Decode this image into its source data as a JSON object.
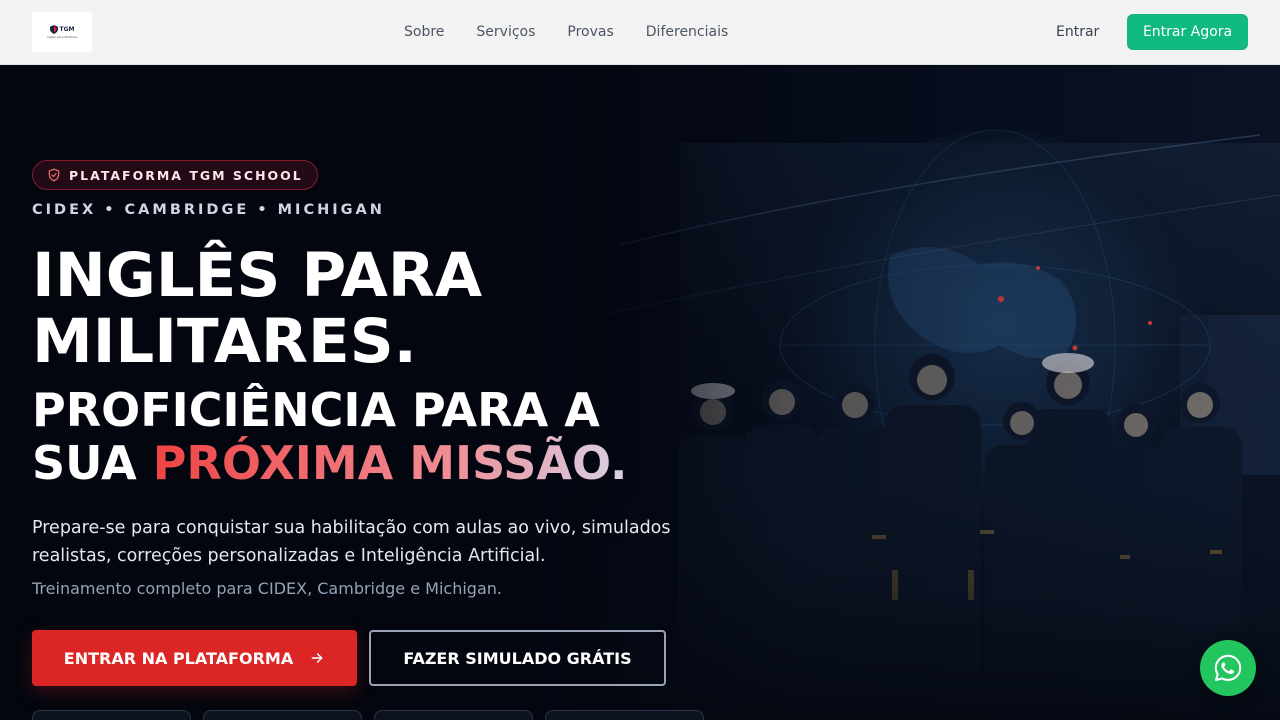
{
  "header": {
    "logo_text": "TGM",
    "logo_sub": "Inglês para Militares",
    "nav": [
      "Sobre",
      "Serviços",
      "Provas",
      "Diferenciais"
    ],
    "signin_label": "Entrar",
    "cta_label": "Entrar Agora"
  },
  "hero": {
    "badge": "PLATAFORMA TGM SCHOOL",
    "exams": "CIDEX • CAMBRIDGE • MICHIGAN",
    "title_line1": "INGLÊS PARA",
    "title_line2": "MILITARES.",
    "subtitle_lead": "PROFICIÊNCIA PARA A SUA ",
    "subtitle_highlight": "PRÓXIMA MISSÃO.",
    "description": "Prepare-se para conquistar sua habilitação com aulas ao vivo, simulados realistas, correções personalizadas e Inteligência Artificial.",
    "secondary_text": "Treinamento completo para CIDEX, Cambridge e Michigan.",
    "primary_button": "ENTRAR NA PLATAFORMA",
    "secondary_button": "FAZER SIMULADO GRÁTIS"
  },
  "colors": {
    "accent_green": "#10b981",
    "accent_red": "#dc2626",
    "whatsapp_green": "#22c55e",
    "hero_bg": "#050814"
  },
  "icons": [
    "shield-check-icon",
    "arrow-right-icon",
    "whatsapp-icon"
  ]
}
